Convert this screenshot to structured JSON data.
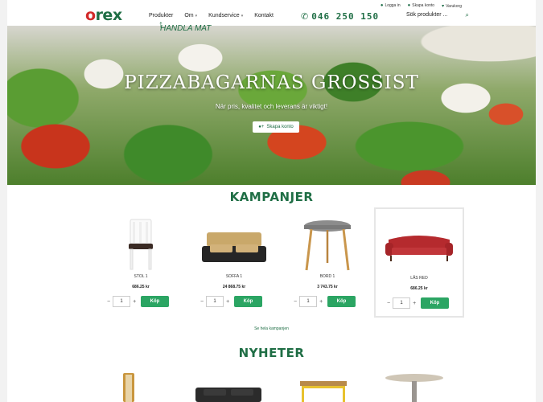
{
  "topbar": {
    "login": "Logga in",
    "create_account": "Skapa konto",
    "cart": "Varukorg"
  },
  "header": {
    "logo": "orex",
    "nav": [
      "Produkter",
      "Om",
      "Kundservice",
      "Kontakt"
    ],
    "phone": "046 250 150",
    "search_placeholder": "Sök produkter ...",
    "annotation": "HANDLA MAT"
  },
  "hero": {
    "title": "PIZZABAGARNAS GROSSIST",
    "subtitle": "När pris, kvalitet och leverans är viktigt!",
    "button": "Skapa konto"
  },
  "kampanjer": {
    "title": "KAMPANJER",
    "products": [
      {
        "name": "STOL 1",
        "price": "686.25 kr",
        "qty": "1",
        "buy": "Köp"
      },
      {
        "name": "SOFFA 1",
        "price": "24 868.75 kr",
        "qty": "1",
        "buy": "Köp"
      },
      {
        "name": "BORD 1",
        "price": "3 743.75 kr",
        "qty": "1",
        "buy": "Köp"
      },
      {
        "name": "LÅS RED",
        "price": "686.25 kr",
        "qty": "1",
        "buy": "Köp"
      }
    ],
    "see_all": "Se hela kampanjen"
  },
  "nyheter": {
    "title": "NYHETER"
  },
  "colors": {
    "brand_green": "#1f6e45",
    "button_green": "#2ba563",
    "logo_red": "#d22a2a"
  }
}
